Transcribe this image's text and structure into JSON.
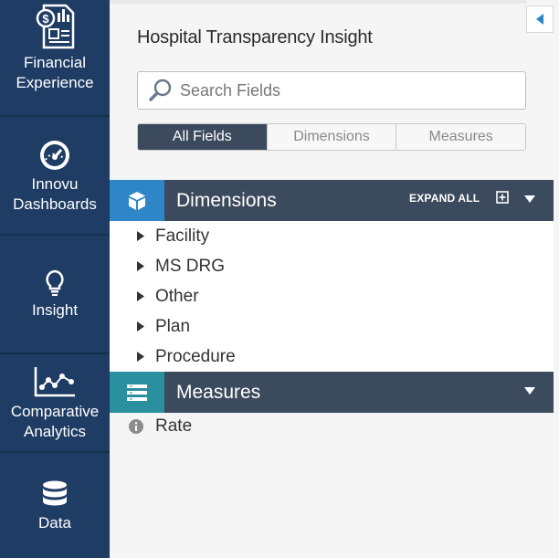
{
  "nav": {
    "items": [
      {
        "label": "Financial\nExperience",
        "icon": "financial-report-icon"
      },
      {
        "label": "Innovu\nDashboards",
        "icon": "gauge-icon"
      },
      {
        "label": "Insight",
        "icon": "lightbulb-icon"
      },
      {
        "label": "Comparative\nAnalytics",
        "icon": "line-chart-icon"
      },
      {
        "label": "Data",
        "icon": "database-icon"
      }
    ]
  },
  "panel": {
    "title": "Hospital Transparency Insight",
    "search": {
      "placeholder": "Search Fields",
      "value": ""
    },
    "tabs": [
      "All Fields",
      "Dimensions",
      "Measures"
    ],
    "selected_tab": "All Fields"
  },
  "dimensions": {
    "title": "Dimensions",
    "expand_all": "EXPAND ALL",
    "items": [
      "Facility",
      "MS DRG",
      "Other",
      "Plan",
      "Procedure"
    ]
  },
  "measures": {
    "title": "Measures",
    "items": [
      "Rate"
    ]
  },
  "colors": {
    "nav_bg": "#1f3c64",
    "section_header": "#3b4a5c",
    "dimensions_accent": "#2e86c8",
    "measures_accent": "#2a8f9e",
    "collapse_arrow": "#2e86c8"
  }
}
